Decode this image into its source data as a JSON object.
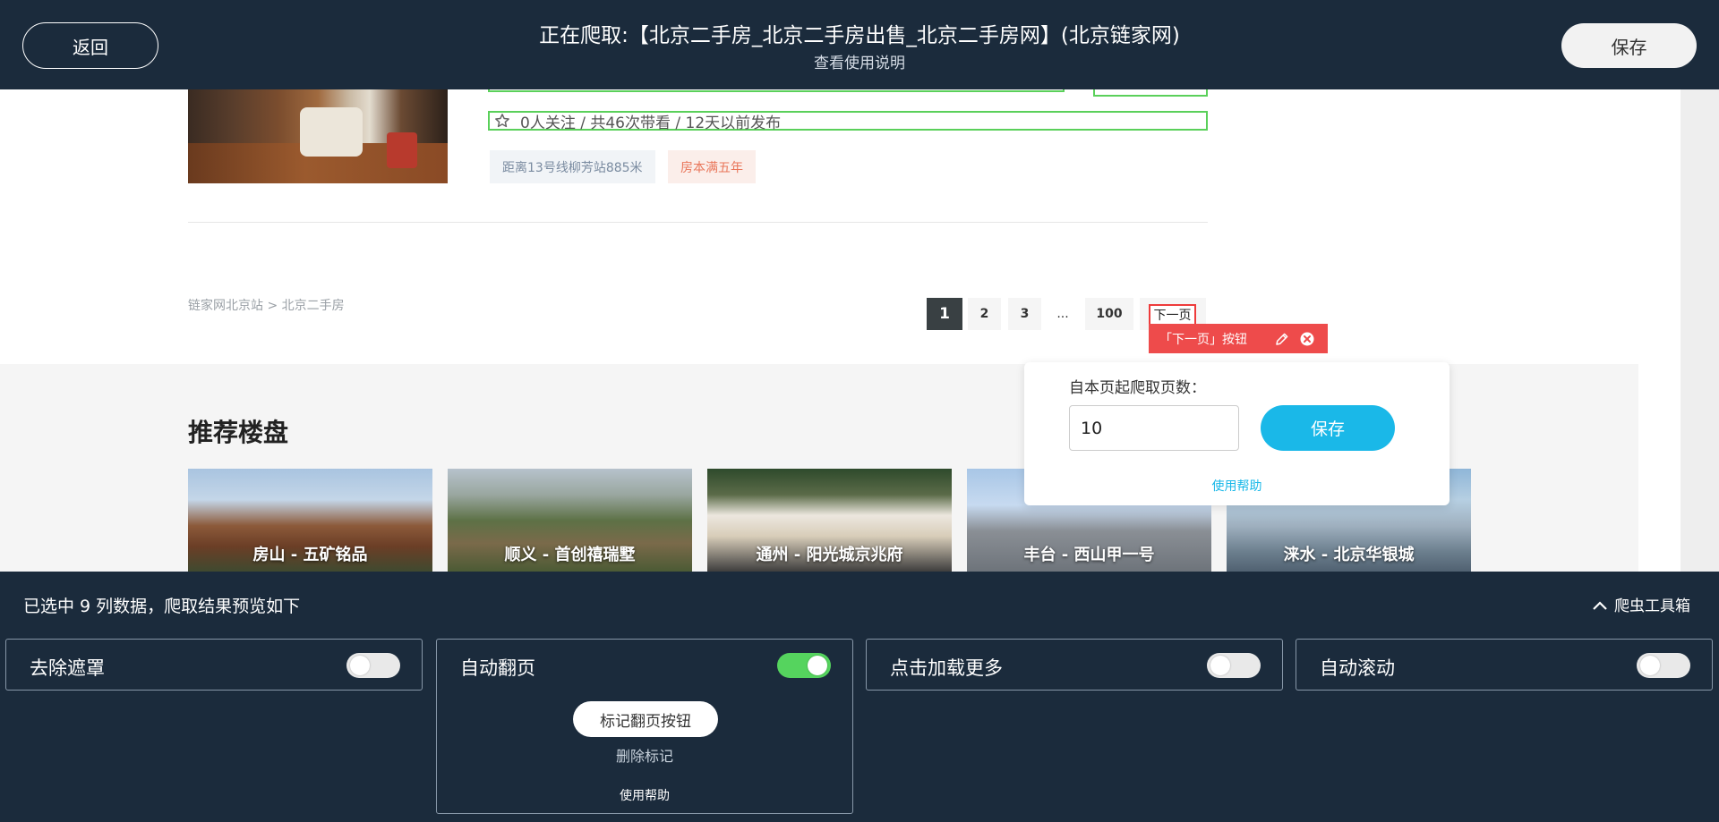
{
  "topbar": {
    "back_label": "返回",
    "title": "正在爬取:【北京二手房_北京二手房出售_北京二手房网】(北京链家网)",
    "help_link": "查看使用说明",
    "save_label": "保存"
  },
  "listing": {
    "follow_text": "0人关注 / 共46次带看 / 12天以前发布",
    "tags": [
      "距离13号线柳芳站885米",
      "房本满五年"
    ]
  },
  "breadcrumb": "链家网北京站 > 北京二手房",
  "pagination": {
    "pages": [
      "1",
      "2",
      "3",
      "...",
      "100"
    ],
    "current": "1",
    "next_label": "下一页",
    "next_marker_label": "「下一页」按钮"
  },
  "recommend": {
    "title": "推荐楼盘",
    "cards": [
      "房山 - 五矿铭品",
      "顺义 - 首创禧瑞墅",
      "通州 - 阳光城京兆府",
      "丰台 - 西山甲一号",
      "涞水 - 北京华银城"
    ]
  },
  "popup": {
    "label": "自本页起爬取页数：",
    "pages_value": "10",
    "save_label": "保存",
    "help_label": "使用帮助"
  },
  "toolbox": {
    "status": "已选中 9 列数据，爬取结果预览如下",
    "toggle_label": "爬虫工具箱",
    "panels": [
      {
        "title": "去除遮罩",
        "enabled": false
      },
      {
        "title": "自动翻页",
        "enabled": true,
        "mark_button": "标记翻页按钮",
        "delete_mark": "删除标记",
        "help": "使用帮助"
      },
      {
        "title": "点击加载更多",
        "enabled": false
      },
      {
        "title": "自动滚动",
        "enabled": false
      }
    ]
  },
  "colors": {
    "dark_bar": "#1b2b3c",
    "accent_blue": "#1ab8e8",
    "switch_on": "#55d45e",
    "select_green": "#5ad05a",
    "marker_red": "#ee4b4b"
  }
}
